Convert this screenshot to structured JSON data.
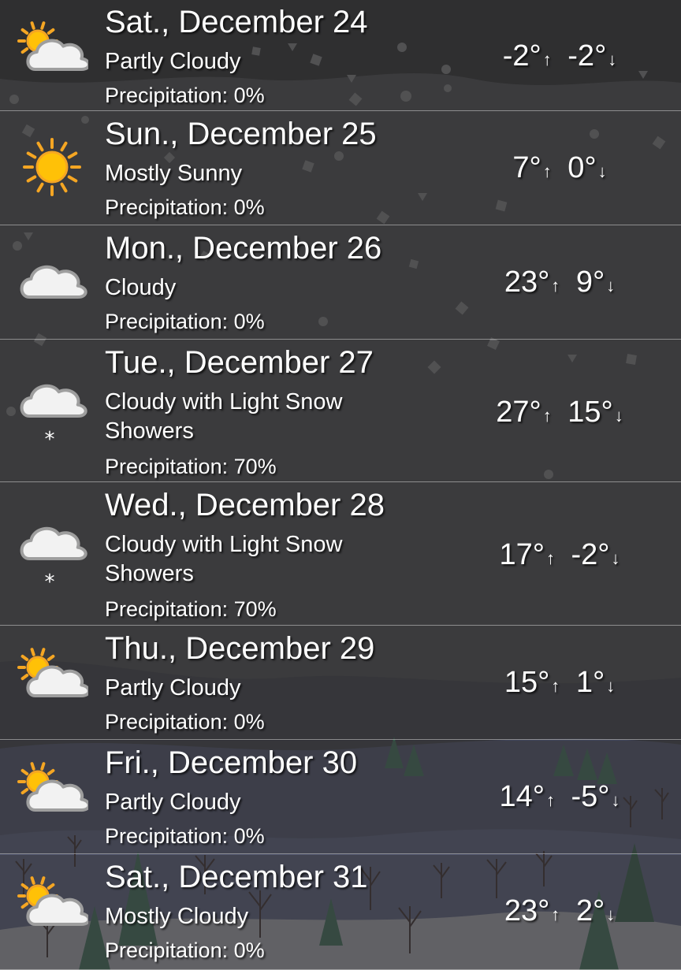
{
  "forecast": [
    {
      "day": "Sat., December 24",
      "condition": "Partly Cloudy",
      "precipitation": "Precipitation: 0%",
      "high": "-2°",
      "low": "-2°",
      "icon": "partly-cloudy-icon"
    },
    {
      "day": "Sun., December 25",
      "condition": "Mostly Sunny",
      "precipitation": "Precipitation: 0%",
      "high": "7°",
      "low": "0°",
      "icon": "sun-icon"
    },
    {
      "day": "Mon., December 26",
      "condition": "Cloudy",
      "precipitation": "Precipitation: 0%",
      "high": "23°",
      "low": "9°",
      "icon": "cloud-icon"
    },
    {
      "day": "Tue., December 27",
      "condition": "Cloudy with Light Snow Showers",
      "precipitation": "Precipitation: 70%",
      "high": "27°",
      "low": "15°",
      "icon": "snow-cloud-icon"
    },
    {
      "day": "Wed., December 28",
      "condition": "Cloudy with Light Snow Showers",
      "precipitation": "Precipitation: 70%",
      "high": "17°",
      "low": "-2°",
      "icon": "snow-cloud-icon"
    },
    {
      "day": "Thu., December 29",
      "condition": "Partly Cloudy",
      "precipitation": "Precipitation: 0%",
      "high": "15°",
      "low": "1°",
      "icon": "partly-cloudy-icon"
    },
    {
      "day": "Fri., December 30",
      "condition": "Partly Cloudy",
      "precipitation": "Precipitation: 0%",
      "high": "14°",
      "low": "-5°",
      "icon": "partly-cloudy-icon"
    },
    {
      "day": "Sat., December 31",
      "condition": "Mostly Cloudy",
      "precipitation": "Precipitation: 0%",
      "high": "23°",
      "low": "2°",
      "icon": "partly-cloudy-icon"
    }
  ],
  "symbols": {
    "up_arrow": "↑",
    "down_arrow": "↓"
  },
  "colors": {
    "sun": "#ffc107",
    "sun_ray": "#f5a623",
    "cloud": "#f2f2f2",
    "cloud_outline": "#9e9e9e"
  }
}
